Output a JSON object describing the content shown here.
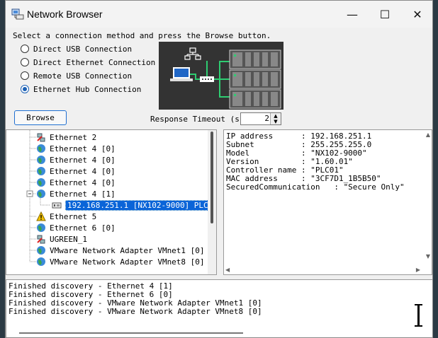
{
  "window": {
    "title": "Network Browser",
    "minimize_icon": "minimize-icon",
    "maximize_icon": "maximize-icon",
    "close_icon": "close-icon"
  },
  "instruction": "Select a connection method and press the Browse button.",
  "connection_methods": [
    {
      "label": "Direct USB Connection",
      "selected": false
    },
    {
      "label": "Direct Ethernet Connection",
      "selected": false
    },
    {
      "label": "Remote USB Connection",
      "selected": false
    },
    {
      "label": "Ethernet Hub Connection",
      "selected": true
    }
  ],
  "browse_label": "Browse",
  "response_timeout": {
    "label": "Response Timeout (s)",
    "value": "2"
  },
  "tree": [
    {
      "label": "Ethernet 2",
      "icon": "disconnected-network-icon",
      "level": 1
    },
    {
      "label": "Ethernet 4 [0]",
      "icon": "globe-network-icon",
      "level": 1
    },
    {
      "label": "Ethernet 4 [0]",
      "icon": "globe-network-icon",
      "level": 1
    },
    {
      "label": "Ethernet 4 [0]",
      "icon": "globe-network-icon",
      "level": 1
    },
    {
      "label": "Ethernet 4 [0]",
      "icon": "globe-network-icon",
      "level": 1
    },
    {
      "label": "Ethernet 4 [1]",
      "icon": "globe-network-icon",
      "level": 1,
      "expanded": true
    },
    {
      "label": "192.168.251.1 [NX102-9000] PLC01",
      "icon": "controller-icon",
      "level": 2,
      "selected": true
    },
    {
      "label": "Ethernet 5",
      "icon": "warning-icon",
      "level": 1
    },
    {
      "label": "Ethernet 6 [0]",
      "icon": "globe-network-icon",
      "level": 1
    },
    {
      "label": "UGREEN_1",
      "icon": "disconnected-network-icon",
      "level": 1
    },
    {
      "label": "VMware Network Adapter VMnet1 [0]",
      "icon": "globe-network-icon",
      "level": 1
    },
    {
      "label": "VMware Network Adapter VMnet8 [0]",
      "icon": "globe-network-icon",
      "level": 1
    }
  ],
  "properties": [
    "IP address      : 192.168.251.1",
    "Subnet          : 255.255.255.0",
    "Model           : \"NX102-9000\"",
    "Version         : \"1.60.01\"",
    "Controller name : \"PLC01\"",
    "MAC address     : \"3CF7D1_1B5B50\"",
    "SecuredCommunication   : \"Secure Only\""
  ],
  "log": [
    "Finished discovery - Ethernet 4 [1]",
    "Finished discovery - Ethernet 6 [0]",
    "Finished discovery - VMware Network Adapter VMnet1 [0]",
    "Finished discovery - VMware Network Adapter VMnet8 [0]"
  ],
  "colors": {
    "accent": "#0a64d8",
    "radio_selected": "#1a5fb4",
    "diagram_bg": "#333333",
    "link_green": "#2ecc71"
  }
}
